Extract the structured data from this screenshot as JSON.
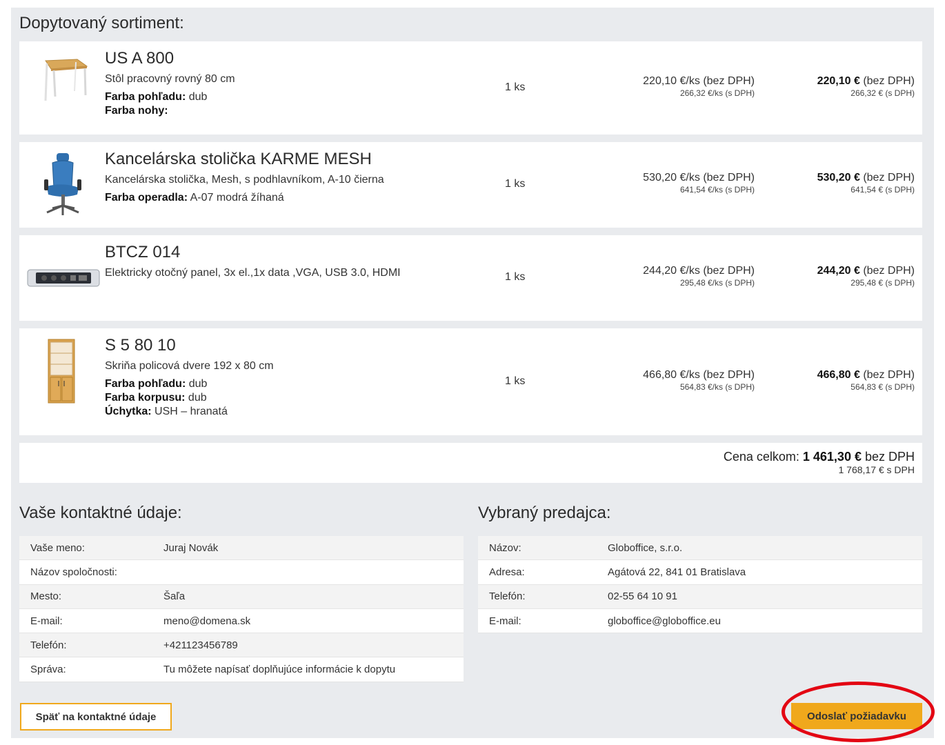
{
  "sortiment": {
    "title": "Dopytovaný sortiment:",
    "items": [
      {
        "name": "US A 800",
        "description": "Stôl pracovný rovný 80 cm",
        "attrs": [
          {
            "label": "Farba pohľadu:",
            "value": " dub"
          },
          {
            "label": "Farba nohy:",
            "value": ""
          }
        ],
        "qty": "1 ks",
        "unit_price": "220,10 €/ks (bez DPH)",
        "unit_price_vat": "266,32 €/ks (s DPH)",
        "total_amount": "220,10 €",
        "total_suffix": " (bez DPH)",
        "total_vat": "266,32 € (s DPH)",
        "image": "desk-image"
      },
      {
        "name": "Kancelárska stolička KARME MESH",
        "description": "Kancelárska stolička, Mesh, s podhlavníkom, A-10 čierna",
        "attrs": [
          {
            "label": "Farba operadla:",
            "value": " A-07 modrá žíhaná"
          }
        ],
        "qty": "1 ks",
        "unit_price": "530,20 €/ks (bez DPH)",
        "unit_price_vat": "641,54 €/ks (s DPH)",
        "total_amount": "530,20 €",
        "total_suffix": " (bez DPH)",
        "total_vat": "641,54 € (s DPH)",
        "image": "chair-image"
      },
      {
        "name": "BTCZ 014",
        "description": "Elektricky otočný panel, 3x el.,1x data ,VGA, USB 3.0, HDMI",
        "attrs": [],
        "qty": "1 ks",
        "unit_price": "244,20 €/ks (bez DPH)",
        "unit_price_vat": "295,48 €/ks (s DPH)",
        "total_amount": "244,20 €",
        "total_suffix": " (bez DPH)",
        "total_vat": "295,48 € (s DPH)",
        "image": "panel-image"
      },
      {
        "name": "S 5 80 10",
        "description": "Skriňa policová dvere 192 x 80 cm",
        "attrs": [
          {
            "label": "Farba pohľadu:",
            "value": " dub"
          },
          {
            "label": "Farba korpusu:",
            "value": " dub"
          },
          {
            "label": "Úchytka:",
            "value": " USH – hranatá"
          }
        ],
        "qty": "1 ks",
        "unit_price": "466,80 €/ks (bez DPH)",
        "unit_price_vat": "564,83 €/ks (s DPH)",
        "total_amount": "466,80 €",
        "total_suffix": " (bez DPH)",
        "total_vat": "564,83 € (s DPH)",
        "image": "cabinet-image"
      }
    ],
    "total_label": "Cena celkom: ",
    "total_amount": "1 461,30 €",
    "total_suffix": " bez DPH",
    "total_vat": "1 768,17 € s DPH"
  },
  "contact": {
    "title": "Vaše kontaktné údaje:",
    "rows": [
      {
        "label": "Vaše meno:",
        "value": "Juraj Novák"
      },
      {
        "label": "Názov spoločnosti:",
        "value": ""
      },
      {
        "label": "Mesto:",
        "value": "Šaľa"
      },
      {
        "label": "E-mail:",
        "value": "meno@domena.sk"
      },
      {
        "label": "Telefón:",
        "value": "+421123456789"
      },
      {
        "label": "Správa:",
        "value": "Tu môžete napísať doplňujúce informácie k dopytu"
      }
    ]
  },
  "seller": {
    "title": "Vybraný predajca:",
    "rows": [
      {
        "label": "Názov:",
        "value": "Globoffice, s.r.o."
      },
      {
        "label": "Adresa:",
        "value": "Agátová 22, 841 01 Bratislava"
      },
      {
        "label": "Telefón:",
        "value": "02-55 64 10 91"
      },
      {
        "label": "E-mail:",
        "value": "globoffice@globoffice.eu"
      }
    ]
  },
  "actions": {
    "back_label": "Späť na kontaktné údaje",
    "send_label": "Odoslať požiadavku"
  },
  "colors": {
    "accent": "#f0a81c",
    "highlight": "#e30613",
    "panel_bg": "#e9ebee"
  }
}
